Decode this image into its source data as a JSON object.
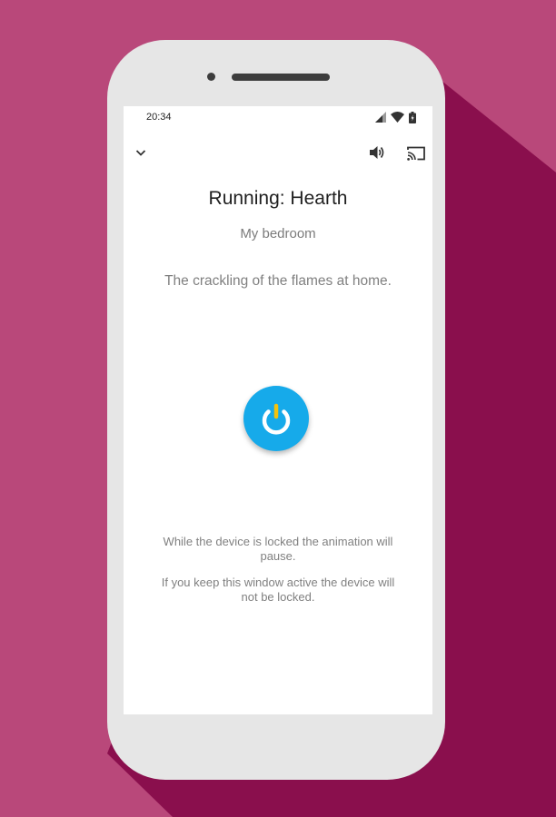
{
  "status_bar": {
    "time": "20:34",
    "icons": [
      "signal-icon",
      "wifi-icon",
      "battery-icon"
    ]
  },
  "app_bar": {
    "icons": [
      "chevron-down-icon",
      "volume-icon",
      "cast-icon"
    ]
  },
  "main": {
    "title": "Running: Hearth",
    "room": "My bedroom",
    "description": "The crackling of the flames at home.",
    "power_icon": "power-icon",
    "note_lock_pause": "While the device is locked the animation will pause.",
    "note_keep_active": "If you keep this window active the device will not be locked."
  },
  "colors": {
    "background": "#b9487a",
    "background_shadow": "#8a0f4d",
    "phone_body": "#e6e6e6",
    "power_button": "#16aaea",
    "power_accent": "#f4c20d"
  }
}
